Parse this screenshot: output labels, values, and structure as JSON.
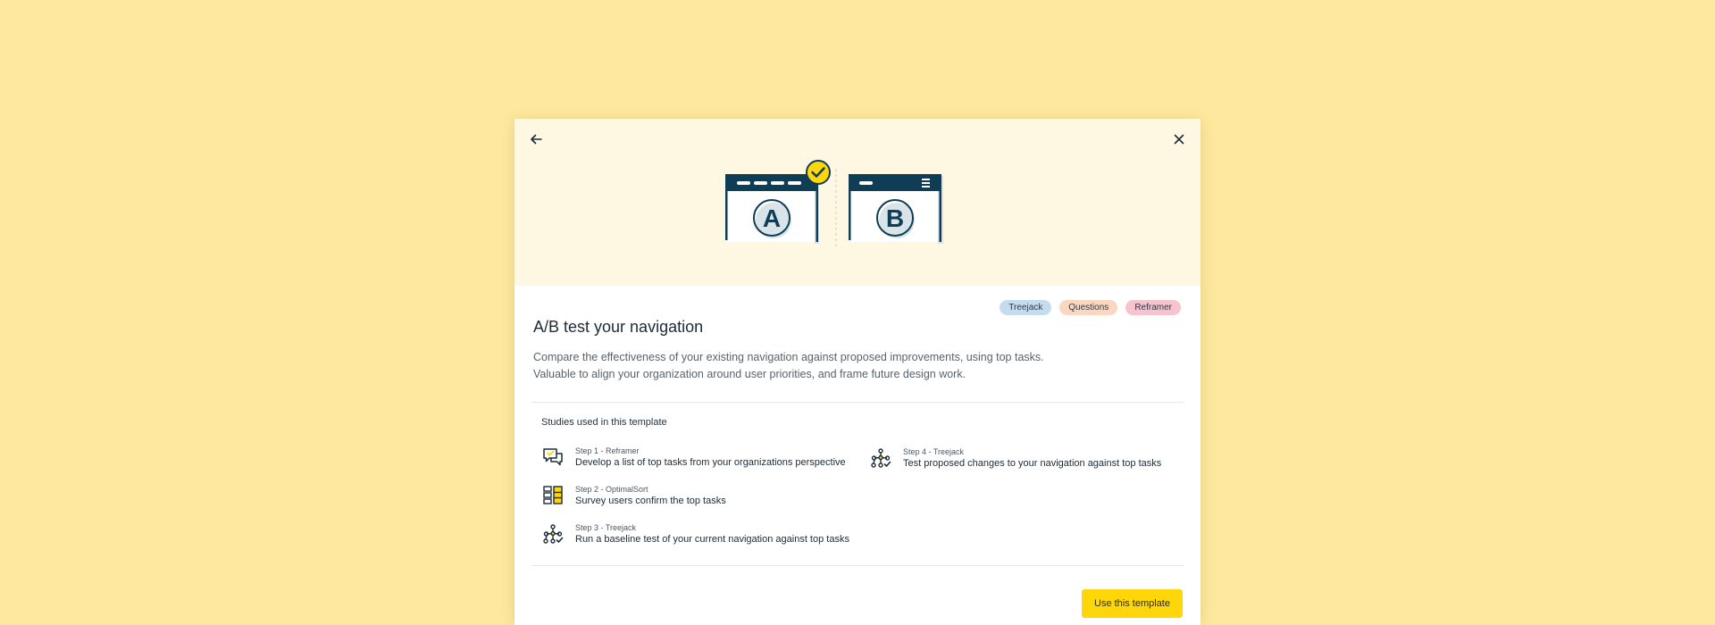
{
  "modal": {
    "back_icon": "arrow-left-icon",
    "close_icon": "close-icon",
    "illustration": {
      "variant_a_letter": "A",
      "variant_b_letter": "B",
      "accent": "#ffd60a",
      "dark": "#0f3d56"
    },
    "tags": [
      {
        "label": "Treejack",
        "color": "#c5dcef"
      },
      {
        "label": "Questions",
        "color": "#fbd7c0"
      },
      {
        "label": "Reframer",
        "color": "#f7c3cc"
      }
    ],
    "title": "A/B test your navigation",
    "description_lines": [
      "Compare the effectiveness of your existing navigation against proposed improvements, using top tasks.",
      "Valuable to align your organization around user priorities, and frame future design work."
    ],
    "studies": {
      "heading": "Studies used in this template",
      "steps": [
        {
          "label": "Step 1 - Reframer",
          "description": "Develop a list of top tasks from your organizations perspective",
          "icon": "reframer-chat-icon"
        },
        {
          "label": "Step 2 - OptimalSort",
          "description": "Survey users confirm the top tasks",
          "icon": "optimalsort-cards-icon"
        },
        {
          "label": "Step 3 - Treejack",
          "description": "Run a baseline test of your current navigation against top tasks",
          "icon": "treejack-tree-icon"
        },
        {
          "label": "Step 4 - Treejack",
          "description": "Test proposed changes to your navigation against top tasks",
          "icon": "treejack-tree-icon"
        }
      ]
    },
    "cta_label": "Use this template"
  }
}
